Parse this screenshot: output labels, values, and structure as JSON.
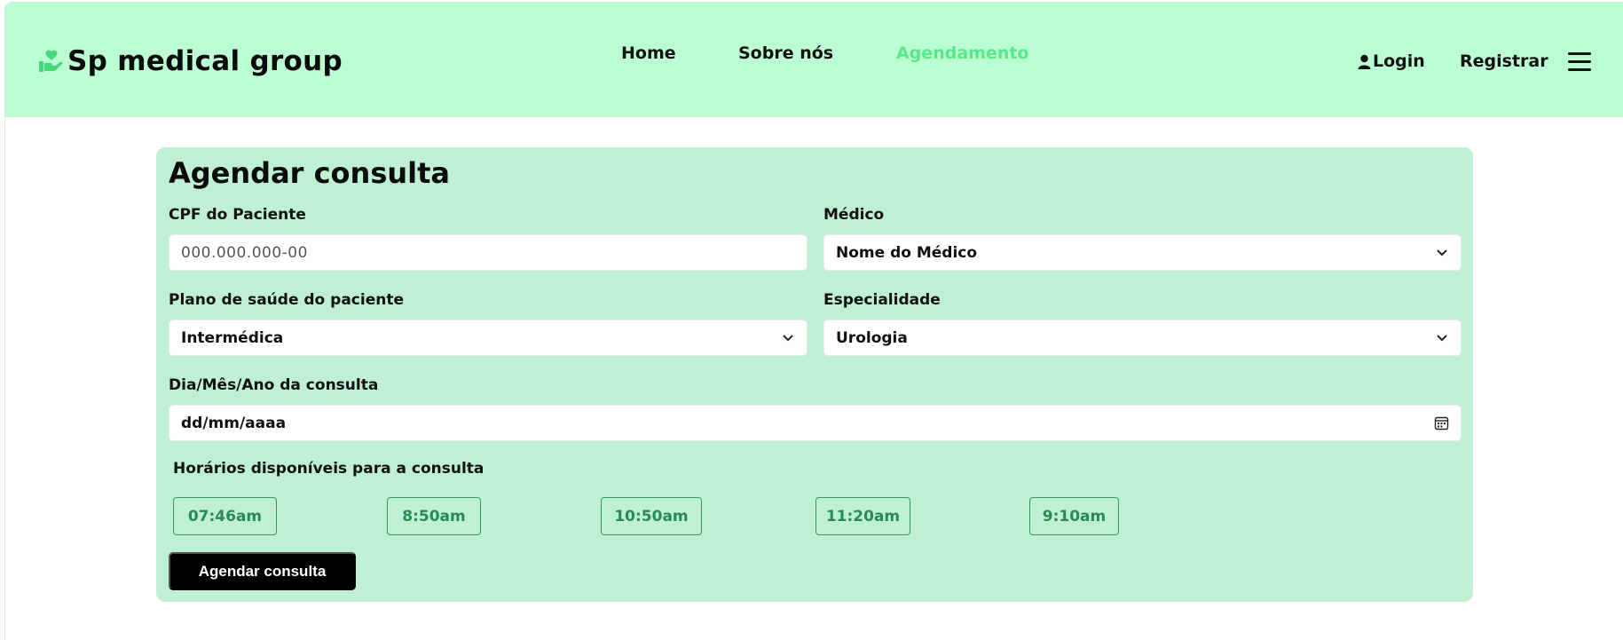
{
  "navbar": {
    "brand_name": "Sp medical group",
    "brand_icon": "hand-heart-icon",
    "links": [
      {
        "label": "Home",
        "active": false
      },
      {
        "label": "Sobre nós",
        "active": false
      },
      {
        "label": "Agendamento",
        "active": true
      }
    ],
    "login_label": "Login",
    "register_label": "Registrar"
  },
  "form": {
    "title": "Agendar consulta",
    "cpf": {
      "label": "CPF do Paciente",
      "placeholder": "000.000.000-00",
      "value": ""
    },
    "doctor": {
      "label": "Médico",
      "value": "Nome do Médico"
    },
    "plan": {
      "label": "Plano de saúde do paciente",
      "value": "Intermédica"
    },
    "specialty": {
      "label": "Especialidade",
      "value": "Urologia"
    },
    "date": {
      "label": "Dia/Mês/Ano da consulta",
      "value": "dd/mm/aaaa"
    },
    "times_label": "Horários disponíveis para a consulta",
    "times": [
      "07:46am",
      "8:50am",
      "10:50am",
      "11:20am",
      "9:10am"
    ],
    "submit_label": "Agendar consulta"
  },
  "colors": {
    "navbar_bg": "#bcfed3",
    "active_link": "#58e88a",
    "card_bg": "#bff0d3",
    "slot_border": "#2f9b5c",
    "submit_bg": "#000000"
  }
}
